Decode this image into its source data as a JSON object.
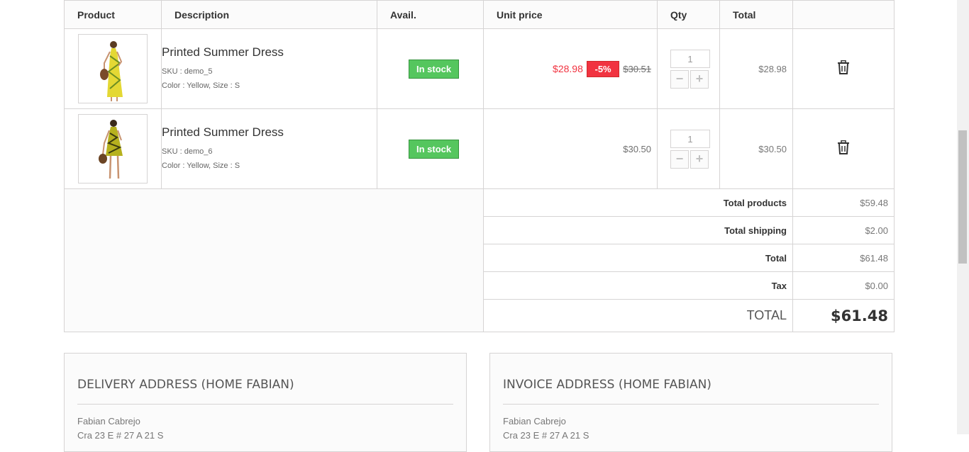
{
  "headers": {
    "product": "Product",
    "description": "Description",
    "avail": "Avail.",
    "unit_price": "Unit price",
    "qty": "Qty",
    "total": "Total"
  },
  "items": [
    {
      "name": "Printed Summer Dress",
      "sku": "SKU : demo_5",
      "attributes": "Color : Yellow, Size : S",
      "availability": "In stock",
      "special_price": "$28.98",
      "reduction": "-5%",
      "old_price": "$30.51",
      "qty": "1",
      "total": "$28.98"
    },
    {
      "name": "Printed Summer Dress",
      "sku": "SKU : demo_6",
      "attributes": "Color : Yellow, Size : S",
      "availability": "In stock",
      "price": "$30.50",
      "qty": "1",
      "total": "$30.50"
    }
  ],
  "summary": {
    "total_products_label": "Total products",
    "total_products": "$59.48",
    "total_shipping_label": "Total shipping",
    "total_shipping": "$2.00",
    "total_label": "Total",
    "total": "$61.48",
    "tax_label": "Tax",
    "tax": "$0.00",
    "grand_label": "TOTAL",
    "grand_total": "$61.48"
  },
  "delivery": {
    "title": "DELIVERY ADDRESS (HOME FABIAN)",
    "name": "Fabian Cabrejo",
    "line2": "Cra 23 E # 27 A 21 S"
  },
  "invoice": {
    "title": "INVOICE ADDRESS (HOME FABIAN)",
    "name": "Fabian Cabrejo",
    "line2": "Cra 23 E # 27 A 21 S"
  },
  "colors": {
    "stock_green": "#55c65e",
    "discount_red": "#f13340",
    "border": "#d6d4d4"
  }
}
